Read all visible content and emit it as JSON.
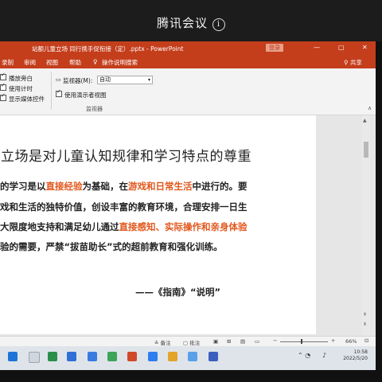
{
  "meeting": {
    "title": "腾讯会议"
  },
  "ppt": {
    "window_title": "站额儿童立场 同行携手促衔接（定）.pptx - PowerPoint",
    "login_label": "登录",
    "window_controls": [
      "—",
      "▢",
      "✕"
    ],
    "tabs": [
      "录制",
      "审阅",
      "视图",
      "帮助"
    ],
    "search_placeholder": "操作说明搜索",
    "share_label": "共享"
  },
  "ribbon": {
    "checkboxes": [
      {
        "label": "播放旁白",
        "checked": true
      },
      {
        "label": "使用计时",
        "checked": true
      },
      {
        "label": "显示媒体控件",
        "checked": true
      }
    ],
    "monitor_label": "监视器(M):",
    "monitor_value": "自动",
    "presenter_view_label": "使用演示者视图",
    "group_label": "监视器"
  },
  "slide": {
    "heading": "立场是对儿童认知规律和学习特点的尊重",
    "lines": [
      [
        {
          "text": "的学习是以",
          "hl": false
        },
        {
          "text": "直接经验",
          "hl": true
        },
        {
          "text": "为基础，在",
          "hl": false
        },
        {
          "text": "游戏和日常生活",
          "hl": true
        },
        {
          "text": "中进行的。要",
          "hl": false
        }
      ],
      [
        {
          "text": "戏和生活的独特价值，创设丰富的教育环境，合理安排一日生",
          "hl": false
        }
      ],
      [
        {
          "text": "大限度地支持和满足幼儿通过",
          "hl": false
        },
        {
          "text": "直接感知、实际操作和亲身体验",
          "hl": true
        }
      ],
      [
        {
          "text": "验的需要，严禁“拔苗助长”式的超前教育和强化训练。",
          "hl": false
        }
      ]
    ],
    "attribution": "——《指南》“说明”",
    "accent_color": "#e1571c"
  },
  "status_bar": {
    "notes_label": "备注",
    "comments_label": "批注",
    "zoom": "66%"
  },
  "taskbar": {
    "time": "10:58",
    "date": "2022/5/20"
  }
}
